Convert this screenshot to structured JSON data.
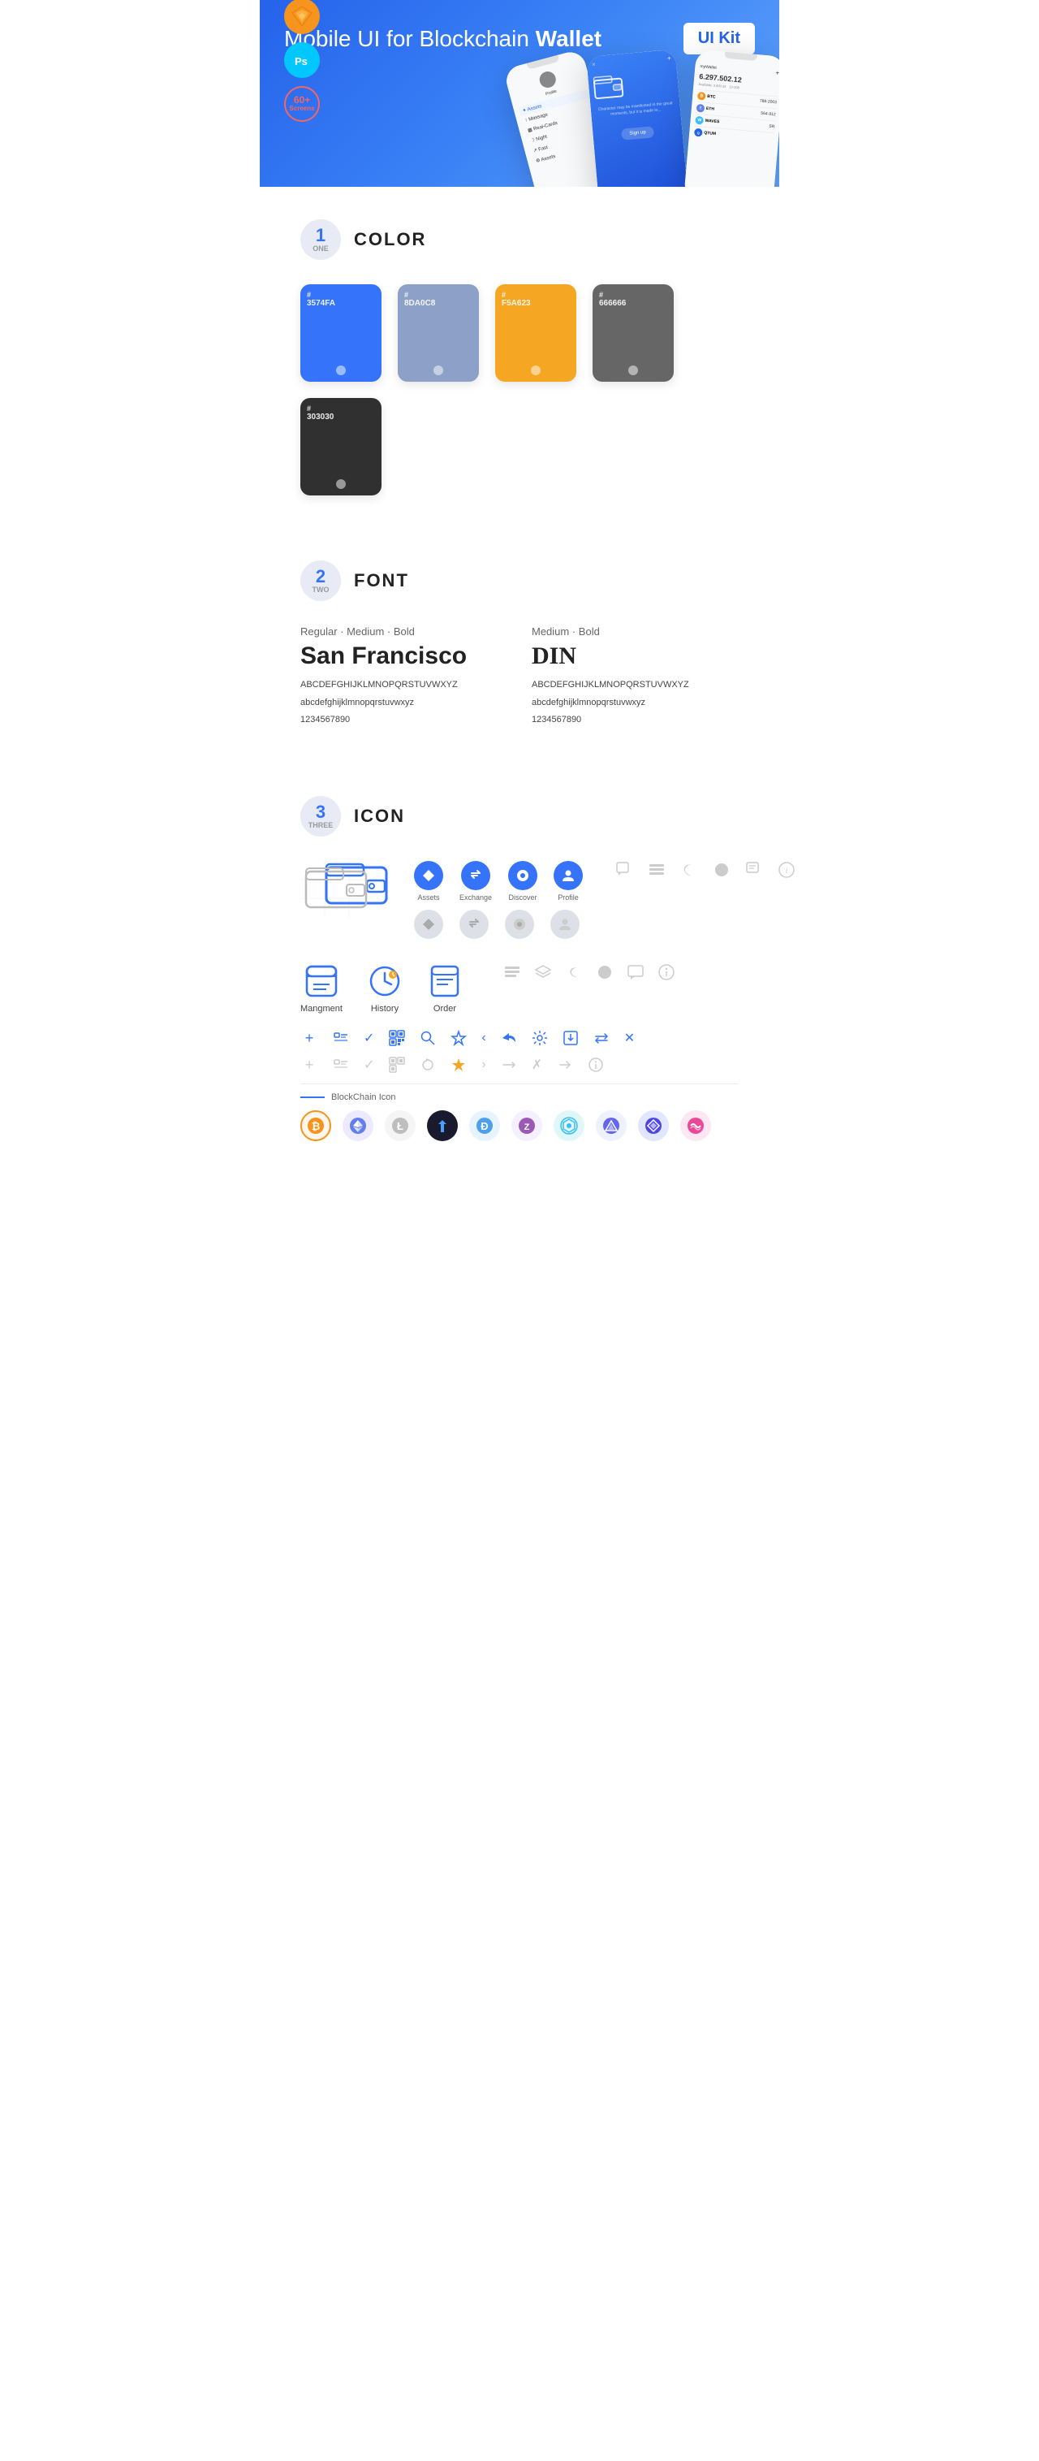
{
  "hero": {
    "title_regular": "Mobile UI for Blockchain ",
    "title_bold": "Wallet",
    "badge": "UI Kit",
    "sketch_label": "Sketch",
    "ps_label": "Ps",
    "screens_label": "60+\nScreens"
  },
  "sections": {
    "color": {
      "number": "1",
      "sub": "ONE",
      "title": "COLOR",
      "swatches": [
        {
          "hex": "#3574FA",
          "label": "#\n3574FA",
          "bg": "#3574FA"
        },
        {
          "hex": "#8DA0C8",
          "label": "#\n8DA0C8",
          "bg": "#8DA0C8"
        },
        {
          "hex": "#F5A623",
          "label": "#\nF5A623",
          "bg": "#F5A623"
        },
        {
          "hex": "#666666",
          "label": "#\n666666",
          "bg": "#666666"
        },
        {
          "hex": "#303030",
          "label": "#\n303030",
          "bg": "#303030"
        }
      ]
    },
    "font": {
      "number": "2",
      "sub": "TWO",
      "title": "FONT",
      "fonts": [
        {
          "weights": "Regular · Medium · Bold",
          "name": "San Francisco",
          "uppercase": "ABCDEFGHIJKLMNOPQRSTUVWXYZ",
          "lowercase": "abcdefghijklmnopqrstuvwxyz",
          "numbers": "1234567890"
        },
        {
          "weights": "Medium · Bold",
          "name": "DIN",
          "uppercase": "ABCDEFGHIJKLMNOPQRSTUVWXYZ",
          "lowercase": "abcdefghijklmnopqrstuvwxyz",
          "numbers": "1234567890"
        }
      ]
    },
    "icon": {
      "number": "3",
      "sub": "THREE",
      "title": "ICON",
      "named_icons": [
        {
          "label": "Assets",
          "symbol": "◆"
        },
        {
          "label": "Exchange",
          "symbol": "♋"
        },
        {
          "label": "Discover",
          "symbol": "⬤"
        },
        {
          "label": "Profile",
          "symbol": "⌒"
        }
      ],
      "function_icons": [
        "Mangment",
        "History",
        "Order"
      ],
      "small_icons": [
        "+",
        "☰",
        "✓",
        "▦",
        "🔍",
        "☆",
        "‹",
        "‹‹",
        "⚙",
        "⬜",
        "⇌",
        "✕"
      ],
      "small_icons2": [
        "+",
        "☰",
        "✓",
        "▦",
        "↺",
        "★",
        "›",
        "↔",
        "✗",
        "→",
        "ℹ"
      ],
      "blockchain_label": "BlockChain Icon",
      "crypto": [
        {
          "symbol": "₿",
          "color": "#f7931a",
          "bg": "#fff3e0"
        },
        {
          "symbol": "Ξ",
          "color": "#627eea",
          "bg": "#ede9fe"
        },
        {
          "symbol": "Ł",
          "color": "#a0a0a0",
          "bg": "#f3f4f6"
        },
        {
          "symbol": "◈",
          "color": "#1a1a2e",
          "bg": "#e8e8f0"
        },
        {
          "symbol": "Ð",
          "color": "#4e9fee",
          "bg": "#dbeafe"
        },
        {
          "symbol": "Z",
          "color": "#9b59b6",
          "bg": "#ede9fe"
        },
        {
          "symbol": "⬡",
          "color": "#38bdf8",
          "bg": "#e0f7fa"
        },
        {
          "symbol": "◭",
          "color": "#6366f1",
          "bg": "#eef2ff"
        },
        {
          "symbol": "♦",
          "color": "#4f46e5",
          "bg": "#e0e7ff"
        },
        {
          "symbol": "∞",
          "color": "#ec4899",
          "bg": "#fce7f3"
        }
      ]
    }
  }
}
